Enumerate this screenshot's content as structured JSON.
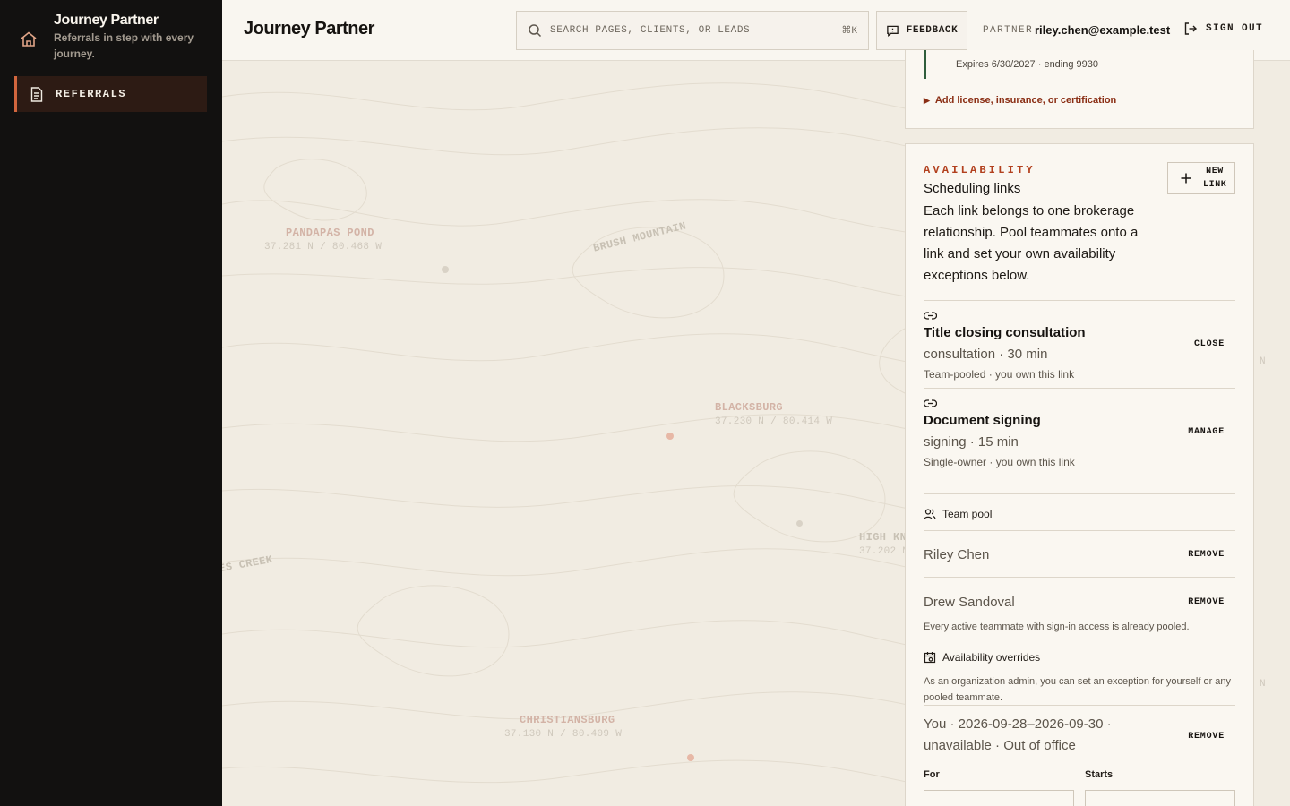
{
  "app": {
    "name": "Journey Partner",
    "tagline": "Referrals in step with every journey."
  },
  "sidebar": {
    "items": [
      {
        "label": "REFERRALS",
        "icon": "document-icon",
        "active": true
      }
    ]
  },
  "header": {
    "title": "Journey Partner",
    "search_placeholder": "SEARCH PAGES, CLIENTS, OR LEADS",
    "search_shortcut": "⌘K",
    "feedback_label": "FEEDBACK",
    "partner_label": "PARTNER",
    "partner_email": "riley.chen@example.test",
    "signout_label": "SIGN OUT"
  },
  "map": {
    "places": [
      {
        "name": "PANDAPAS POND",
        "coord": "37.281 N / 80.468 W"
      },
      {
        "name": "BRUSH MOUNTAIN"
      },
      {
        "name": "BLACKSBURG",
        "coord": "37.230 N / 80.414 W"
      },
      {
        "name": "HIGH KN",
        "coord": "37.202 N"
      },
      {
        "name": "ES CREEK"
      },
      {
        "name": "CHRISTIANSBURG",
        "coord": "37.130 N / 80.409 W"
      }
    ],
    "edge_letters": [
      "N",
      "N"
    ]
  },
  "credentials": {
    "expiry": "Expires 6/30/2027 · ending 9930",
    "add_label": "Add license, insurance, or certification"
  },
  "availability": {
    "eyebrow": "AVAILABILITY",
    "title": "Scheduling links",
    "description": "Each link belongs to one brokerage relationship. Pool teammates onto a link and set your own availability exceptions below.",
    "new_link_label": "NEW LINK",
    "links": [
      {
        "name": "Title closing consultation",
        "meta": "consultation · 30 min",
        "ownership": "Team-pooled · you own this link",
        "action": "CLOSE"
      },
      {
        "name": "Document signing",
        "meta": "signing · 15 min",
        "ownership": "Single-owner · you own this link",
        "action": "MANAGE"
      }
    ],
    "team_pool": {
      "title": "Team pool",
      "members": [
        {
          "name": "Riley Chen",
          "action": "REMOVE"
        },
        {
          "name": "Drew Sandoval",
          "action": "REMOVE"
        }
      ],
      "note": "Every active teammate with sign-in access is already pooled."
    },
    "overrides": {
      "title": "Availability overrides",
      "note": "As an organization admin, you can set an exception for yourself or any pooled teammate.",
      "items": [
        {
          "text": "You · 2026-09-28–2026-09-30 · unavailable · Out of office",
          "action": "REMOVE"
        }
      ],
      "form": {
        "for_label": "For",
        "starts_label": "Starts"
      }
    }
  },
  "colors": {
    "sidebar_bg": "#121110",
    "accent": "#d1663e",
    "eyebrow": "#b2401e",
    "credential_bar": "#2f5d3c"
  }
}
